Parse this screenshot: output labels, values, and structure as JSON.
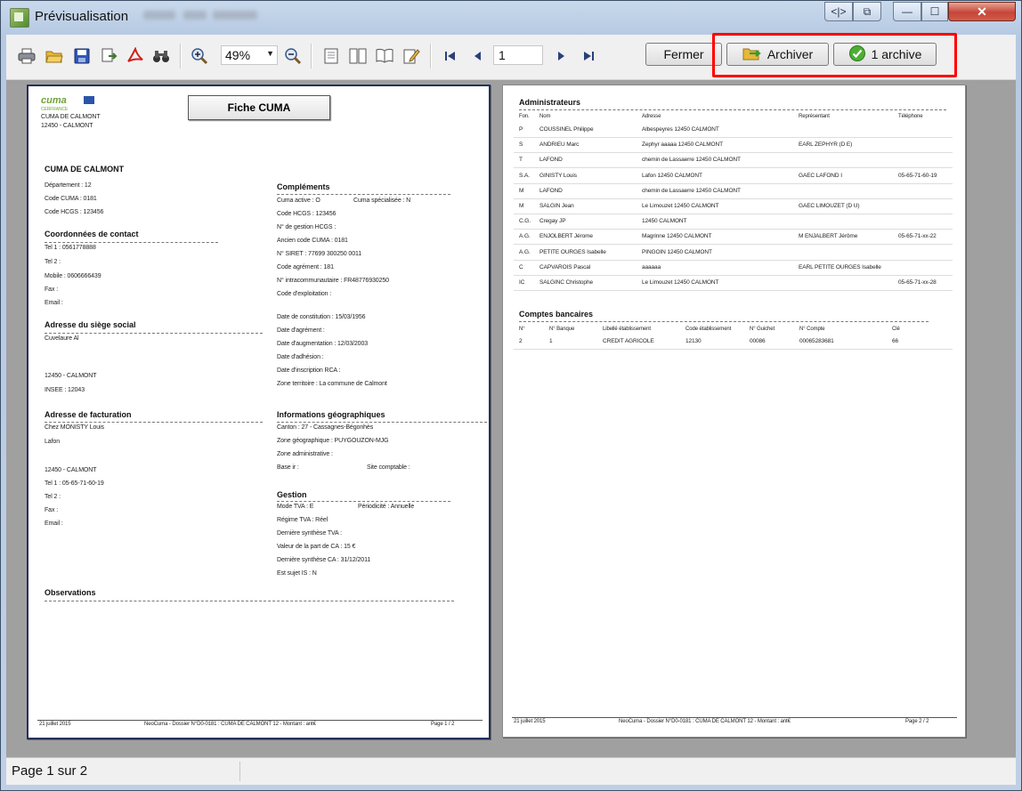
{
  "window": {
    "title": "Prévisualisation",
    "controls": {
      "minimize": "—",
      "maximize": "☐",
      "close": "✕"
    }
  },
  "toolbar": {
    "zoom_value": "49%",
    "page_value": "1",
    "fermer_label": "Fermer",
    "archiver_label": "Archiver",
    "archive_count_label": "1 archive",
    "icons": [
      "print-icon",
      "open-folder-icon",
      "save-icon",
      "export-icon",
      "pdf-icon",
      "binoculars-icon",
      "zoom-in-icon",
      "zoom-out-icon",
      "single-page-icon",
      "two-page-icon",
      "book-icon",
      "edit-icon",
      "first-page-icon",
      "prev-page-icon",
      "next-page-icon",
      "last-page-icon"
    ]
  },
  "page1": {
    "logo_text": "cuma",
    "logo_subtitle": "CERFRANCE",
    "header_line1": "CUMA DE CALMONT",
    "header_line2": "12450 - CALMONT",
    "fiche_title": "Fiche CUMA",
    "section_main_title": "CUMA DE CALMONT",
    "departement": "Département : 12",
    "code_cuma": "Code CUMA : 0181",
    "code_hcgs": "Code HCGS : 123456",
    "coord_title": "Coordonnées de contact",
    "tel": "Tel 1 : 0561778888",
    "tel2": "Tel 2 :",
    "mobile": "Mobile : 0606666439",
    "fax": "Fax :",
    "email": "Email :",
    "siege_title": "Adresse du siège social",
    "siege_line1": "Cuvelaure Al",
    "siege_city": "12450 - CALMONT",
    "siege_insee": "INSEE : 12043",
    "fact_title": "Adresse de facturation",
    "fact_line1": "Chez MONISTY Louis",
    "fact_line2": "Lafon",
    "fact_city": "12450 - CALMONT",
    "fact_tel": "Tel 1 : 05-65-71-60-19",
    "fact_tel2": "Tel 2 :",
    "fact_fax": "Fax :",
    "fact_email": "Email :",
    "obs_title": "Observations",
    "compl_title": "Compléments",
    "cuma_active": "Cuma active : O",
    "cuma_specialisee": "Cuma spécialisée : N",
    "code_hcgs2": "Code HCGS : 123456",
    "num_gestion": "N° de gestion HCGS :",
    "ancien_code": "Ancien code CUMA : 0181",
    "siret": "N° SIRET : 77699 300250 0011",
    "code_agrement": "Code agrément : 181",
    "tva_intra": "N° intracommunautaire : FR48776930250",
    "code_exploitation": "Code d'exploitation :",
    "date_constitution": "Date de constitution : 15/03/1956",
    "date_agrement": "Date d'agrément :",
    "date_augmentation": "Date d'augmentation : 12/03/2003",
    "date_adhesion": "Date d'adhésion :",
    "date_rca": "Date d'inscription RCA :",
    "zone_territoire": "Zone territoire : La commune de Calmont",
    "geo_title": "Informations géographiques",
    "canton": "Canton : 27 - Cassagnes-Bégonhès",
    "zone_geo": "Zone géographique : PUYGOUZON-MJG",
    "zone_admin": "Zone administrative :",
    "base_ir": "Base ir :",
    "site_comptable": "Site comptable :",
    "gestion_title": "Gestion",
    "mode_tva": "Mode TVA : E",
    "periodicite": "Périodicité : Annuelle",
    "regime_tva": "Régime TVA : Réel",
    "derniere_tva": "Dernière synthèse TVA :",
    "valeur_ca": "Valeur de la part de CA : 15 €",
    "derniere_ca": "Dernière synthèse CA : 31/12/2011",
    "sujet_is": "Est sujet IS : N",
    "footer_date": "21 juillet 2015",
    "footer_center": "NeoCuma - Dossier N°D0-0181 : CUMA DE CALMONT 12 - Montant : ant€",
    "footer_page": "Page 1 / 2"
  },
  "page2": {
    "admin_title": "Administrateurs",
    "cols": [
      "Fon.",
      "Nom",
      "Adresse",
      "Représentant",
      "Téléphone"
    ],
    "rows": [
      [
        "P",
        "COUSSINEL Philippe",
        "Albespeyres 12450 CALMONT",
        "",
        ""
      ],
      [
        "S",
        "ANDRIEU Marc",
        "Zephyr aaaaa 12450 CALMONT",
        "EARL ZEPHYR (D E)",
        ""
      ],
      [
        "T",
        "LAFOND",
        "chemin de Lassaerre 12450 CALMONT",
        "",
        ""
      ],
      [
        "S.A.",
        "GINISTY Louis",
        "Lafon 12450 CALMONT",
        "GAEC LAFOND I",
        "05-65-71-60-19"
      ],
      [
        "M",
        "LAFOND",
        "chemin de Lassaerre 12450 CALMONT",
        "",
        ""
      ],
      [
        "M",
        "SALGIN Jean",
        "Le Limouzet 12450 CALMONT",
        "GAEC LIMOUZET (D U)",
        ""
      ],
      [
        "C.G.",
        "Cregay JP",
        "12450 CALMONT",
        "",
        ""
      ],
      [
        "A.G.",
        "ENJOLBERT Jérome",
        "Magrinne 12450 CALMONT",
        "M ENJALBERT Jérôme",
        "05-65-71-xx-22"
      ],
      [
        "A.G.",
        "PETITE OURGES Isabelle",
        "PINGOIN 12450 CALMONT",
        "",
        ""
      ],
      [
        "C",
        "CAPVAROIS Pascal",
        "aaaaaa",
        "EARL PETITE OURGES Isabelle",
        ""
      ],
      [
        "IC",
        "SALGINC Christophe",
        "Le Limouzet 12450 CALMONT",
        "",
        "05-65-71-xx-28"
      ]
    ],
    "bank_title": "Comptes bancaires",
    "bank_cols": [
      "N°",
      "N° Banque",
      "Libellé établissement",
      "Code établissement",
      "N° Guichet",
      "N° Compte",
      "Clé"
    ],
    "bank_rows": [
      [
        "2",
        "1",
        "CREDIT AGRICOLE",
        "12130",
        "00086",
        "00065283681",
        "66"
      ]
    ],
    "footer_date": "21 juillet 2015",
    "footer_center": "NeoCuma - Dossier N°D0-0181 : CUMA DE CALMONT 12 - Montant : ant€",
    "footer_page": "Page 2 / 2"
  },
  "status": {
    "page_info": "Page 1 sur 2"
  },
  "colors": {
    "highlight": "#ff0000",
    "accent_green": "#6ea33a"
  }
}
